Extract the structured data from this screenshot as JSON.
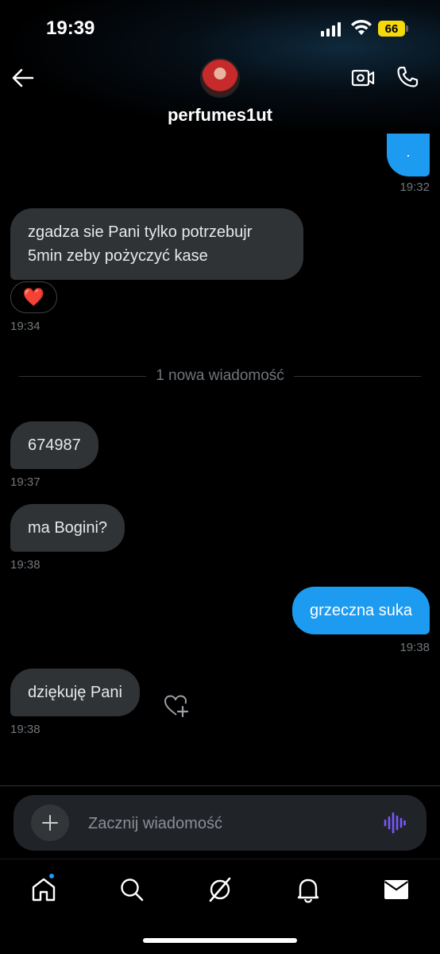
{
  "status_bar": {
    "time": "19:39",
    "battery": "66"
  },
  "header": {
    "username": "perfumes1ut"
  },
  "messages": {
    "m1": {
      "text": "·",
      "time": "19:32"
    },
    "m2": {
      "text": "zgadza sie Pani tylko potrzebujr 5min zeby pożyczyć kase",
      "time": "19:34",
      "reaction": "❤️"
    },
    "divider": "1 nowa wiadomość",
    "m3": {
      "text": "674987",
      "time": "19:37"
    },
    "m4": {
      "text": "ma Bogini?",
      "time": "19:38"
    },
    "m5": {
      "text": "grzeczna suka",
      "time": "19:38"
    },
    "m6": {
      "text": "dziękuję Pani",
      "time": "19:38"
    }
  },
  "composer": {
    "placeholder": "Zacznij wiadomość"
  },
  "colors": {
    "accent": "#1d9bf0",
    "incoming_bubble": "#2f3336",
    "battery": "#f5d90a",
    "voice_icon": "#7856ff"
  },
  "icons": [
    "back-arrow-icon",
    "video-icon",
    "phone-icon",
    "heart-plus-icon",
    "plus-icon",
    "voice-wave-icon",
    "home-icon",
    "search-icon",
    "grok-icon",
    "bell-icon",
    "mail-icon"
  ]
}
